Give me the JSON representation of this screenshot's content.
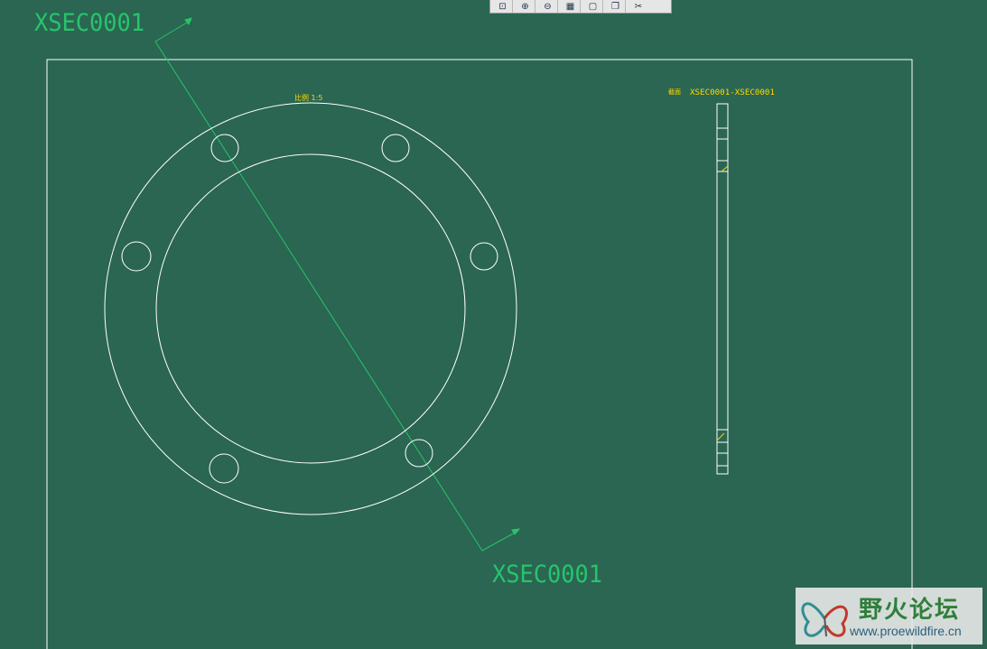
{
  "colors": {
    "background": "#2a6652",
    "geometry": "#ffffff",
    "cutting_plane": "#27c46c",
    "annotation": "#ffd700"
  },
  "toolbar": {
    "buttons": [
      {
        "icon": "zoom-fit-icon",
        "glyph": "⊡"
      },
      {
        "icon": "zoom-in-icon",
        "glyph": "⊕"
      },
      {
        "icon": "zoom-out-icon",
        "glyph": "⊖"
      },
      {
        "icon": "repaint-icon",
        "glyph": "▦"
      },
      {
        "icon": "new-sheet-icon",
        "glyph": "▢"
      },
      {
        "icon": "copy-sheet-icon",
        "glyph": "❐"
      },
      {
        "icon": "tools-icon",
        "glyph": "✂"
      }
    ]
  },
  "drawing": {
    "section_name_top": "XSEC0001",
    "section_name_bottom": "XSEC0001",
    "scale_label": "比例 1:5",
    "section_view_label_prefix": "截面",
    "section_view_label": "XSEC0001-XSEC0001"
  },
  "watermark": {
    "title": "野火论坛",
    "url": "www.proewildfire.cn"
  }
}
